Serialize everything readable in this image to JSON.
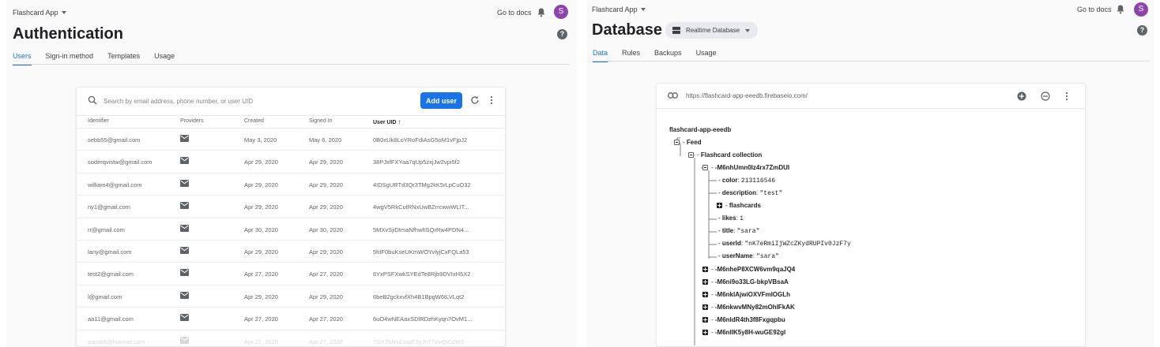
{
  "left": {
    "project_name": "Flashcard App",
    "docs_link": "Go to docs",
    "avatar_letter": "S",
    "title": "Authentication",
    "tabs": [
      "Users",
      "Sign-in method",
      "Templates",
      "Usage"
    ],
    "active_tab": "Users",
    "search_placeholder": "Search by email address, phone number, or user UID",
    "add_user_label": "Add user",
    "columns": [
      "Identifier",
      "Providers",
      "Created",
      "Signed In",
      "User UID"
    ],
    "rows": [
      {
        "identifier": "sebb55@gmail.com",
        "created": "May 3, 2020",
        "signed_in": "May 6, 2020",
        "uid": "0B0xUk8LoYRoFdiAsG5oM1vFjpJ2"
      },
      {
        "identifier": "soderqvistw@gmail.com",
        "created": "Apr 29, 2020",
        "signed_in": "Apr 29, 2020",
        "uid": "38PJxfFXYaa7qUp5zxjJw2vpi5f2"
      },
      {
        "identifier": "william4@gmail.com",
        "created": "Apr 29, 2020",
        "signed_in": "Apr 29, 2020",
        "uid": "4IDSgURTd3Qr3TMg2kK5rLpCuO32"
      },
      {
        "identifier": "ny1@gmail.com",
        "created": "Apr 29, 2020",
        "signed_in": "Apr 29, 2020",
        "uid": "4wgV5RkCutRNxUwBZrrcwwWLIT..."
      },
      {
        "identifier": "rr@gmail.com",
        "created": "Apr 30, 2020",
        "signed_in": "Apr 30, 2020",
        "uid": "5MXvSjiDtmaNfhwhSQrRw4PDN4..."
      },
      {
        "identifier": "lany@gmail.com",
        "created": "Apr 29, 2020",
        "signed_in": "Apr 29, 2020",
        "uid": "5hIF0buKseUKmWOYvlyjCxFQLa53"
      },
      {
        "identifier": "test2@gmail.com",
        "created": "Apr 27, 2020",
        "signed_in": "Apr 27, 2020",
        "uid": "6YxPSFXwkSYEdTe8Rjb9DVIxH5X2"
      },
      {
        "identifier": "l@gmail.com",
        "created": "Apr 29, 2020",
        "signed_in": "Apr 29, 2020",
        "uid": "6beB2gckxvfXh4B1BpgW6tLVLqt2"
      },
      {
        "identifier": "aa11@gmail.com",
        "created": "Apr 27, 2020",
        "signed_in": "Apr 27, 2020",
        "uid": "6uO4wNEAaxSDlRDzhKyqn7OvM1..."
      },
      {
        "identifier": "jcaroldt@hotmail.com",
        "created": "Apr 27, 2020",
        "signed_in": "Apr 27, 2020",
        "uid": "7GX7bNvd.IxqF3yJh7?ztvQiCdW2"
      }
    ]
  },
  "right": {
    "project_name": "Flashcard App",
    "docs_link": "Go to docs",
    "avatar_letter": "S",
    "title": "Database",
    "db_selector": "Realtime Database",
    "tabs": [
      "Data",
      "Rules",
      "Backups",
      "Usage"
    ],
    "active_tab": "Data",
    "db_url": "https://flashcard-app-eeedb.firebaseio.com/",
    "tree": {
      "root": "flashcard-app-eeedb",
      "feed": "Feed",
      "collection": "Flashcard collection",
      "expanded_key": "-M6nhUmn0Iz4rx7ZmDUI",
      "fields": [
        {
          "key": "color",
          "value": "213116546"
        },
        {
          "key": "description",
          "value": "\"test\""
        },
        {
          "key": "flashcards",
          "value": ""
        },
        {
          "key": "likes",
          "value": "1"
        },
        {
          "key": "title",
          "value": "\"sara\""
        },
        {
          "key": "userId",
          "value": "\"nK7eRmiIjWZcZKydRUPIv0JzF7y"
        },
        {
          "key": "userName",
          "value": "\"sara\""
        }
      ],
      "collapsed_keys": [
        "-M6nheP8XCW6vm9qaJQ4",
        "-M6ni9o33LG-bkpVBsaA",
        "-M6nkIAjwiOXVFmIOGLh",
        "-M6nkwvMNy82mOhIFkAK",
        "-M6nldR4th3f8Fxgqpbu",
        "-M6nlIK5y8H-wuGE92gl"
      ]
    },
    "colors": {
      "accent": "#1a73e8",
      "avatar": "#8e44ad"
    }
  }
}
